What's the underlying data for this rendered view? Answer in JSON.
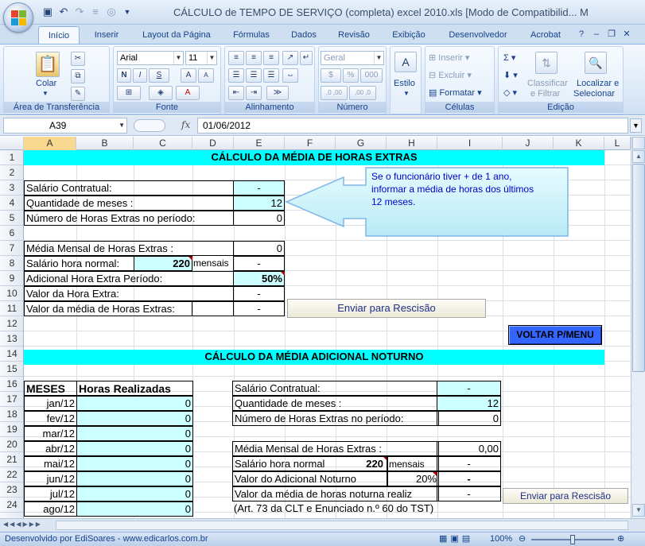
{
  "window": {
    "title": "CÁLCULO de TEMPO DE SERVIÇO (completa) excel 2010.xls  [Modo de Compatibilid... M",
    "qat_icons": [
      "save-icon",
      "undo-icon",
      "redo-icon",
      "customize-icon"
    ]
  },
  "ribbon": {
    "tabs": [
      "Início",
      "Inserir",
      "Layout da Página",
      "Fórmulas",
      "Dados",
      "Revisão",
      "Exibição",
      "Desenvolvedor",
      "Acrobat"
    ],
    "active_tab": "Início",
    "clipboard": {
      "label": "Área de Transferência",
      "paste": "Colar"
    },
    "font": {
      "label": "Fonte",
      "name": "Arial",
      "size": "11",
      "bold": "N",
      "italic": "I",
      "underline": "S",
      "grow": "A",
      "shrink": "A",
      "color": "A"
    },
    "alignment": {
      "label": "Alinhamento"
    },
    "number": {
      "label": "Número",
      "format": "Geral",
      "percent": "%",
      "thousands": "000",
      "inc": ",0 ,00",
      "dec": ",00 ,0"
    },
    "styles": {
      "label": "Estilo"
    },
    "cells": {
      "label": "Células",
      "insert": "Inserir",
      "delete": "Excluir",
      "format": "Formatar"
    },
    "editing": {
      "label": "Edição",
      "sort": "Classificar e Filtrar",
      "sort1": "Classificar",
      "sort2": "e Filtrar",
      "find1": "Localizar e",
      "find2": "Selecionar"
    }
  },
  "formula_bar": {
    "name_box": "A39",
    "fx": "fx",
    "content": "01/06/2012"
  },
  "columns": [
    "A",
    "B",
    "C",
    "D",
    "E",
    "F",
    "G",
    "H",
    "I",
    "J",
    "K",
    "L"
  ],
  "rows": [
    "1",
    "2",
    "3",
    "4",
    "5",
    "6",
    "7",
    "8",
    "9",
    "10",
    "11",
    "12",
    "13",
    "14",
    "15",
    "16",
    "17",
    "18",
    "19",
    "20",
    "21",
    "22",
    "23",
    "24"
  ],
  "sheet": {
    "header1": "CÁLCULO DA MÉDIA DE HORAS EXTRAS",
    "s1": {
      "salario_label": "Salário Contratual:",
      "salario_val": "-",
      "meses_label": "Quantidade de meses :",
      "meses_val": "12",
      "horas_label": "Número de Horas Extras no período:",
      "horas_val": "0",
      "media_label": "Média Mensal de Horas Extras :",
      "media_val": "0",
      "hora_normal_label": "Salário hora normal:",
      "hora_normal_val": "220",
      "mensais": "mensais",
      "hora_normal_res": "-",
      "adicional_label": "Adicional Hora Extra Período:",
      "adicional_val": "50%",
      "valor_hora_label": "Valor da Hora Extra:",
      "valor_hora_val": "-",
      "valor_media_label": "Valor da média de Horas Extras:",
      "valor_media_val": "-"
    },
    "callout": "Se o funcionário tiver + de 1 ano, informar a média de horas dos últimos 12 meses.",
    "enviar1": "Enviar para Rescisão",
    "voltar": "VOLTAR P/MENU",
    "header2": "CÁLCULO DA MÉDIA ADICIONAL NOTURNO",
    "table": {
      "col_meses": "MESES",
      "col_horas": "Horas Realizadas",
      "rows": [
        {
          "mes": "jan/12",
          "val": "0"
        },
        {
          "mes": "fev/12",
          "val": "0"
        },
        {
          "mes": "mar/12",
          "val": "0"
        },
        {
          "mes": "abr/12",
          "val": "0"
        },
        {
          "mes": "mai/12",
          "val": "0"
        },
        {
          "mes": "jun/12",
          "val": "0"
        },
        {
          "mes": "jul/12",
          "val": "0"
        },
        {
          "mes": "ago/12",
          "val": "0"
        }
      ]
    },
    "s2": {
      "salario_label": "Salário Contratual:",
      "salario_val": "-",
      "meses_label": "Quantidade de meses :",
      "meses_val": "12",
      "horas_label": "Número de Horas Extras no período:",
      "horas_val": "0",
      "media_label": "Média Mensal de Horas Extras :",
      "media_val": "0,00",
      "hora_normal_label": "Salário hora normal",
      "hora_normal_val": "220",
      "mensais": "mensais",
      "hora_normal_res": "-",
      "adicional_label": "Valor do Adicional Noturno",
      "adicional_pct": "20%",
      "adicional_val": "-",
      "valor_media_label": "Valor da média de horas noturna realiz",
      "valor_media_val": "-",
      "note": "(Art. 73 da CLT e Enunciado n.º 60 do TST)"
    },
    "enviar2": "Enviar para Rescisão"
  },
  "status": {
    "left": "Desenvolvido por EdiSoares - www.edicarlos.com.br",
    "zoom": "100%",
    "zoom_level_percent": 100
  }
}
